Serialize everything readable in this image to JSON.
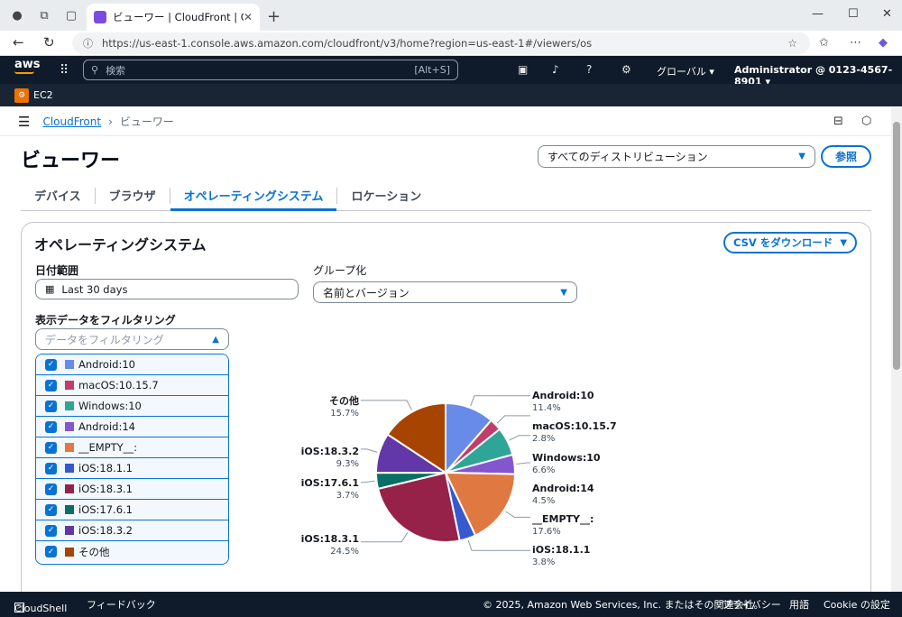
{
  "browser": {
    "tab_title": "ビューワー | CloudFront | Global",
    "url": "https://us-east-1.console.aws.amazon.com/cloudfront/v3/home?region=us-east-1#/viewers/os"
  },
  "aws_nav": {
    "logo": "aws",
    "search_placeholder": "検索",
    "search_shortcut": "[Alt+S]",
    "region": "グローバル",
    "account": "Administrator @ 0123-4567-8901"
  },
  "service_bar": {
    "service": "EC2"
  },
  "breadcrumb": {
    "parent": "CloudFront",
    "current": "ビューワー"
  },
  "header": {
    "title": "ビューワー",
    "distribution_select": "すべてのディストリビューション",
    "reference_button": "参照"
  },
  "tabs": [
    {
      "label": "デバイス"
    },
    {
      "label": "ブラウザ"
    },
    {
      "label": "オペレーティングシステム"
    },
    {
      "label": "ロケーション"
    }
  ],
  "panel": {
    "title": "オペレーティングシステム",
    "csv_button": "CSV をダウンロード",
    "date_label": "日付範囲",
    "date_value": "Last 30 days",
    "group_label": "グループ化",
    "group_value": "名前とバージョン",
    "filter_label": "表示データをフィルタリング",
    "filter_placeholder": "データをフィルタリング"
  },
  "filter_options": [
    {
      "label": "Android:10",
      "color": "#688ae8"
    },
    {
      "label": "macOS:10.15.7",
      "color": "#c33d69"
    },
    {
      "label": "Windows:10",
      "color": "#2ea597"
    },
    {
      "label": "Android:14",
      "color": "#8456ce"
    },
    {
      "label": "__EMPTY__:",
      "color": "#e07941"
    },
    {
      "label": "iOS:18.1.1",
      "color": "#3759ce"
    },
    {
      "label": "iOS:18.3.1",
      "color": "#962249"
    },
    {
      "label": "iOS:17.6.1",
      "color": "#096f64"
    },
    {
      "label": "iOS:18.3.2",
      "color": "#6237a7"
    },
    {
      "label": "その他",
      "color": "#a84401"
    }
  ],
  "chart_data": {
    "type": "pie",
    "slices": [
      {
        "name": "Android:10",
        "value": 11.4,
        "label": "11.4%",
        "color": "#688ae8"
      },
      {
        "name": "macOS:10.15.7",
        "value": 2.8,
        "label": "2.8%",
        "color": "#c33d69"
      },
      {
        "name": "Windows:10",
        "value": 6.6,
        "label": "6.6%",
        "color": "#2ea597"
      },
      {
        "name": "Android:14",
        "value": 4.5,
        "label": "4.5%",
        "color": "#8456ce"
      },
      {
        "name": "__EMPTY__:",
        "value": 17.6,
        "label": "17.6%",
        "color": "#e07941"
      },
      {
        "name": "iOS:18.1.1",
        "value": 3.8,
        "label": "3.8%",
        "color": "#3759ce"
      },
      {
        "name": "iOS:18.3.1",
        "value": 24.5,
        "label": "24.5%",
        "color": "#962249"
      },
      {
        "name": "iOS:17.6.1",
        "value": 3.7,
        "label": "3.7%",
        "color": "#096f64"
      },
      {
        "name": "iOS:18.3.2",
        "value": 9.3,
        "label": "9.3%",
        "color": "#6237a7"
      },
      {
        "name": "その他",
        "value": 15.7,
        "label": "15.7%",
        "color": "#a84401"
      }
    ]
  },
  "footer": {
    "cloudshell": "CloudShell",
    "feedback": "フィードバック",
    "copyright": "© 2025, Amazon Web Services, Inc. またはその関連会社。",
    "privacy": "プライバシー",
    "terms": "用語",
    "cookie": "Cookie の設定"
  }
}
